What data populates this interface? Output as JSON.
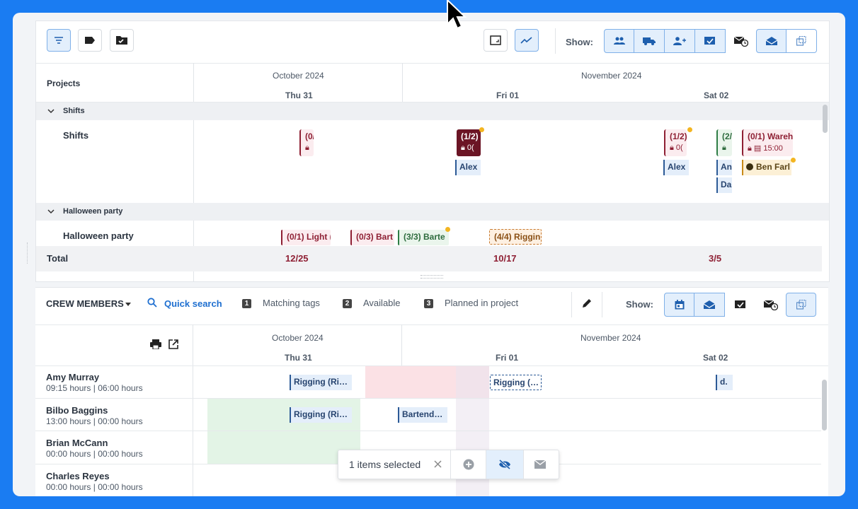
{
  "toolbar": {
    "show_label": "Show:"
  },
  "projects": {
    "column_label": "Projects",
    "months": [
      "October 2024",
      "November 2024"
    ],
    "days": [
      "Thu 31",
      "Fri 01",
      "Sat 02"
    ],
    "groups": [
      {
        "title": "Shifts",
        "row_label": "Shifts"
      },
      {
        "title": "Halloween party",
        "row_label": "Halloween party"
      }
    ],
    "shift_chips": [
      {
        "line1": "(0/",
        "line2": ""
      },
      {
        "line1": "(1/2)",
        "line2": "0("
      },
      {
        "line1": "(1/2)",
        "line2": "0("
      },
      {
        "line1": "(2/",
        "line2": ""
      },
      {
        "line1": "(0/1) Wareh",
        "line2": "15:00"
      }
    ],
    "assignees": [
      "Alex",
      "Alex",
      "An",
      "Da",
      "Ben Farl"
    ],
    "party_chips": [
      "(0/1) Light (",
      "(0/3) Bart",
      "(3/3) Barte",
      "(4/4) Riggin"
    ],
    "total": {
      "label": "Total",
      "values": [
        "12/25",
        "10/17",
        "3/5"
      ]
    }
  },
  "crew": {
    "title": "CREW MEMBERS",
    "quick_search": "Quick search",
    "filters": [
      {
        "num": "1",
        "label": "Matching tags"
      },
      {
        "num": "2",
        "label": "Available"
      },
      {
        "num": "3",
        "label": "Planned in project"
      }
    ],
    "show_label": "Show:",
    "members": [
      {
        "name": "Amy Murray",
        "hours": "09:15 hours",
        "planned": "06:00 hours"
      },
      {
        "name": "Bilbo Baggins",
        "hours": "13:00 hours",
        "planned": "00:00 hours"
      },
      {
        "name": "Brian McCann",
        "hours": "00:00 hours",
        "planned": "00:00 hours"
      },
      {
        "name": "Charles Reyes",
        "hours": "00:00 hours",
        "planned": "00:00 hours"
      }
    ],
    "bookings": [
      "Rigging (Ri…",
      "Rigging (…",
      "d.",
      "Rigging (Ri…",
      "Bartend…"
    ]
  },
  "selection": {
    "text": "1 items selected"
  },
  "colors": {
    "accent": "#1a7cf2",
    "active": "#e3effc",
    "shift_dark": "#6b1525"
  }
}
